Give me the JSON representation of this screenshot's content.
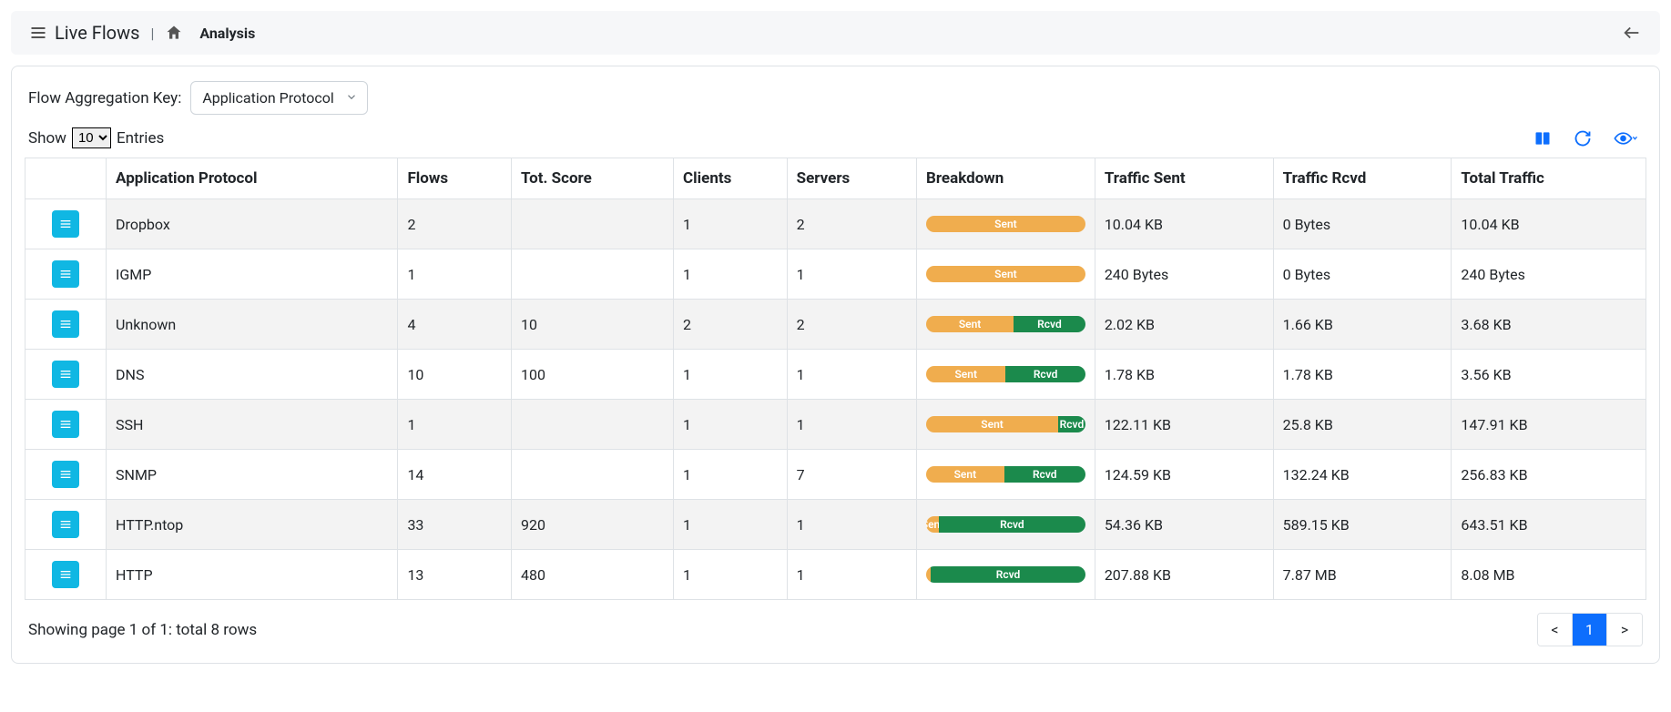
{
  "header": {
    "live_flows": "Live Flows",
    "analysis": "Analysis"
  },
  "controls": {
    "agg_key_label": "Flow Aggregation Key:",
    "agg_key_value": "Application Protocol",
    "show_label": "Show",
    "entries_label": "Entries",
    "page_size": "10"
  },
  "columns": {
    "protocol": "Application Protocol",
    "flows": "Flows",
    "score": "Tot. Score",
    "clients": "Clients",
    "servers": "Servers",
    "breakdown": "Breakdown",
    "sent": "Traffic Sent",
    "rcvd": "Traffic Rcvd",
    "total": "Total Traffic"
  },
  "breakdown_labels": {
    "sent": "Sent",
    "rcvd": "Rcvd"
  },
  "rows": [
    {
      "protocol": "Dropbox",
      "flows": "2",
      "score": "",
      "clients": "1",
      "servers": "2",
      "sent_pct": 100,
      "sent": "10.04 KB",
      "rcvd": "0 Bytes",
      "total": "10.04 KB"
    },
    {
      "protocol": "IGMP",
      "flows": "1",
      "score": "",
      "clients": "1",
      "servers": "1",
      "sent_pct": 100,
      "sent": "240 Bytes",
      "rcvd": "0 Bytes",
      "total": "240 Bytes"
    },
    {
      "protocol": "Unknown",
      "flows": "4",
      "score": "10",
      "clients": "2",
      "servers": "2",
      "sent_pct": 55,
      "sent": "2.02 KB",
      "rcvd": "1.66 KB",
      "total": "3.68 KB"
    },
    {
      "protocol": "DNS",
      "flows": "10",
      "score": "100",
      "clients": "1",
      "servers": "1",
      "sent_pct": 50,
      "sent": "1.78 KB",
      "rcvd": "1.78 KB",
      "total": "3.56 KB"
    },
    {
      "protocol": "SSH",
      "flows": "1",
      "score": "",
      "clients": "1",
      "servers": "1",
      "sent_pct": 83,
      "sent": "122.11 KB",
      "rcvd": "25.8 KB",
      "total": "147.91 KB"
    },
    {
      "protocol": "SNMP",
      "flows": "14",
      "score": "",
      "clients": "1",
      "servers": "7",
      "sent_pct": 49,
      "sent": "124.59 KB",
      "rcvd": "132.24 KB",
      "total": "256.83 KB"
    },
    {
      "protocol": "HTTP.ntop",
      "flows": "33",
      "score": "920",
      "clients": "1",
      "servers": "1",
      "sent_pct": 8,
      "sent": "54.36 KB",
      "rcvd": "589.15 KB",
      "total": "643.51 KB"
    },
    {
      "protocol": "HTTP",
      "flows": "13",
      "score": "480",
      "clients": "1",
      "servers": "1",
      "sent_pct": 3,
      "sent": "207.88 KB",
      "rcvd": "7.87 MB",
      "total": "8.08 MB"
    }
  ],
  "footer": {
    "summary": "Showing page 1 of 1: total 8 rows",
    "prev": "<",
    "page": "1",
    "next": ">"
  }
}
